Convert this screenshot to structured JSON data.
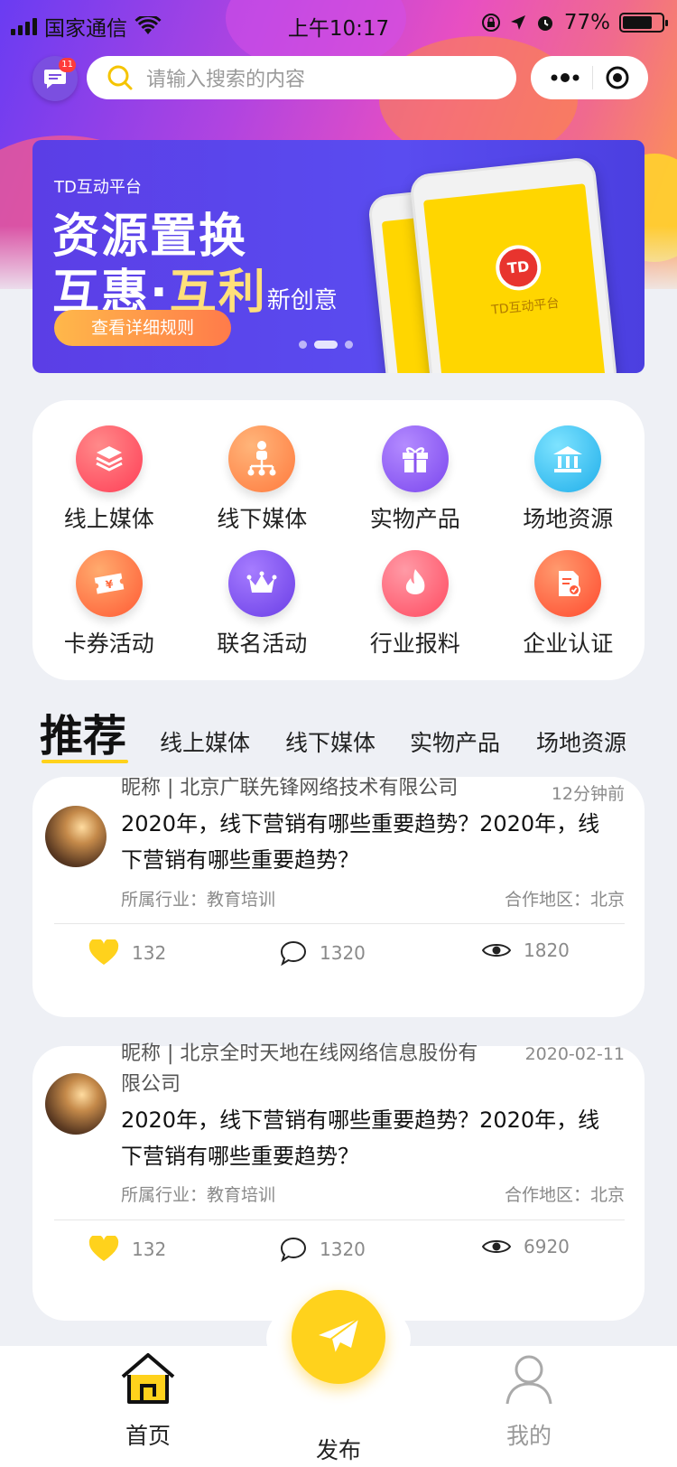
{
  "status_bar": {
    "carrier": "国家通信",
    "time": "上午10:17",
    "battery_percent": "77%"
  },
  "topbar": {
    "message_badge": "11",
    "search_placeholder": "请输入搜索的内容"
  },
  "banner": {
    "subtitle": "TD互动平台",
    "title_line1": "资源置换",
    "title_line2_a": "互惠·",
    "title_line2_b": "互利",
    "title_line2_c": "新创意",
    "button_label": "查看详细规则",
    "phone_logo": "TD",
    "phone_text": "TD互动平台",
    "slide_index": 2,
    "slide_count": 3
  },
  "categories": [
    {
      "label": "线上媒体",
      "icon": "layers-icon",
      "color": "#ff4d5e"
    },
    {
      "label": "线下媒体",
      "icon": "network-icon",
      "color": "#ff8a4e"
    },
    {
      "label": "实物产品",
      "icon": "gift-icon",
      "color": "#8a54f0"
    },
    {
      "label": "场地资源",
      "icon": "building-icon",
      "color": "#2bb6f0"
    },
    {
      "label": "卡券活动",
      "icon": "ticket-icon",
      "color": "#ff6a3d"
    },
    {
      "label": "联名活动",
      "icon": "crown-icon",
      "color": "#7a52ee"
    },
    {
      "label": "行业报料",
      "icon": "fire-icon",
      "color": "#ff5a6a"
    },
    {
      "label": "企业认证",
      "icon": "certificate-icon",
      "color": "#ff5a3a"
    }
  ],
  "tabs": {
    "active": "推荐",
    "items": [
      "线上媒体",
      "线下媒体",
      "实物产品",
      "场地资源"
    ]
  },
  "posts": [
    {
      "header": "昵称 | 北京广联先锋网络技术有限公司",
      "time": "12分钟前",
      "content": "2020年，线下营销有哪些重要趋势？2020年，线下营销有哪些重要趋势？",
      "industry": "所属行业：教育培训",
      "region": "合作地区：北京",
      "likes": "132",
      "comments": "1320",
      "views": "1820"
    },
    {
      "header": "昵称 | 北京全时天地在线网络信息股份有限公司",
      "time": "2020-02-11",
      "content": "2020年，线下营销有哪些重要趋势？2020年，线下营销有哪些重要趋势？",
      "industry": "所属行业：教育培训",
      "region": "合作地区：北京",
      "likes": "132",
      "comments": "1320",
      "views": "6920"
    }
  ],
  "bottom_nav": {
    "home": "首页",
    "publish": "发布",
    "mine": "我的",
    "accent": "#ffd21c"
  }
}
